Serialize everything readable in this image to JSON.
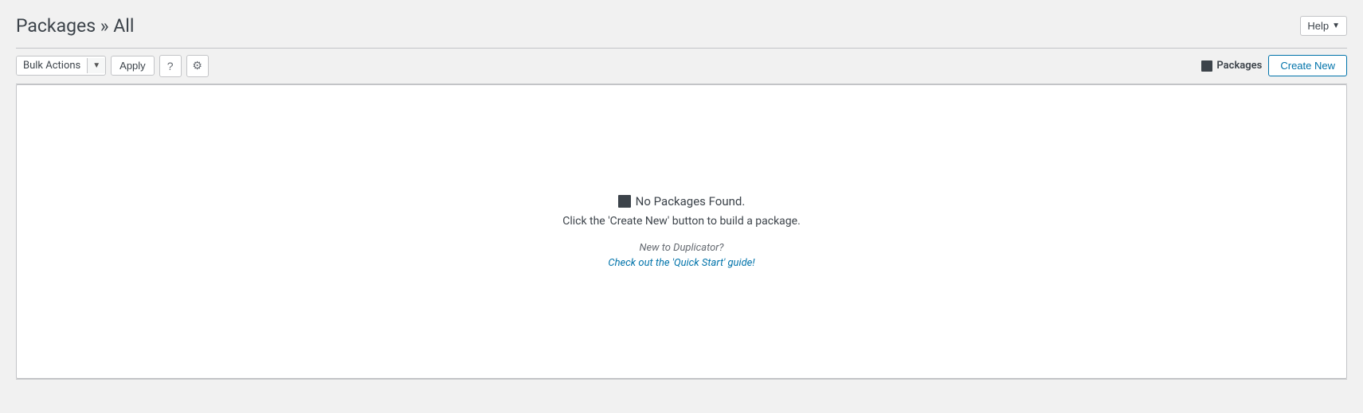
{
  "header": {
    "title": "Packages » All",
    "help_label": "Help",
    "help_chevron": "▼"
  },
  "toolbar": {
    "bulk_actions_label": "Bulk Actions",
    "bulk_actions_arrow": "▼",
    "apply_label": "Apply",
    "question_icon": "?",
    "settings_icon": "⚙",
    "packages_label": "Packages",
    "create_new_label": "Create New"
  },
  "empty_state": {
    "icon_alt": "packages-icon",
    "main_text": "No Packages Found.",
    "sub_text": "Click the 'Create New' button to build a package.",
    "new_to_label": "New to Duplicator?",
    "quick_start_label": "Check out the 'Quick Start' guide!"
  }
}
